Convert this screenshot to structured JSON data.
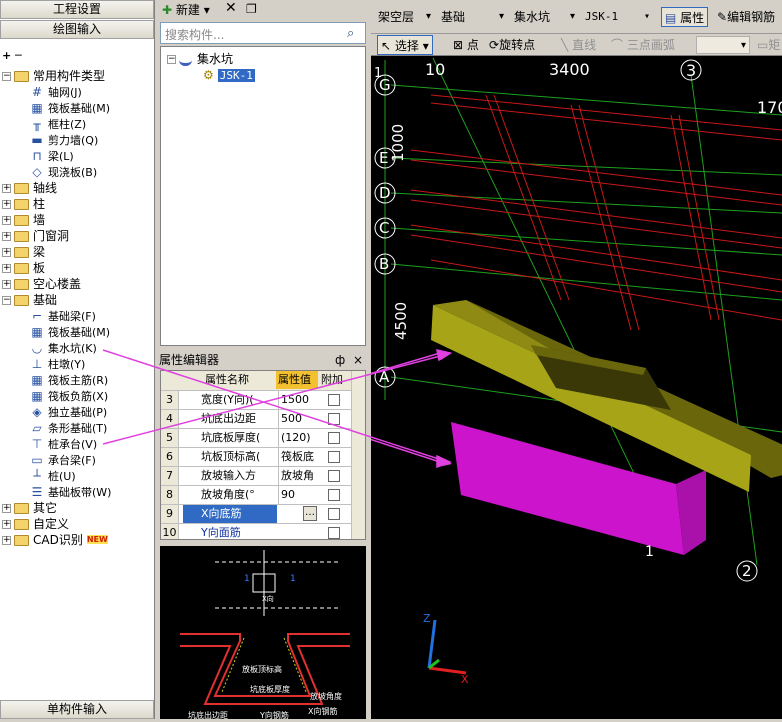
{
  "left_panel": {
    "top_button": "工程设置",
    "second_button": "绘图输入",
    "bottom_button": "单构件输入",
    "tree": [
      {
        "type": "folder",
        "label": "常用构件类型",
        "expanded": true
      },
      {
        "type": "item",
        "label": "轴网(J)",
        "icon": "grid-icon"
      },
      {
        "type": "item",
        "label": "筏板基础(M)",
        "icon": "raft-icon"
      },
      {
        "type": "item",
        "label": "框柱(Z)",
        "icon": "column-icon"
      },
      {
        "type": "item",
        "label": "剪力墙(Q)",
        "icon": "wall-icon"
      },
      {
        "type": "item",
        "label": "梁(L)",
        "icon": "beam-icon"
      },
      {
        "type": "item",
        "label": "现浇板(B)",
        "icon": "slab-icon"
      },
      {
        "type": "folder",
        "label": "轴线"
      },
      {
        "type": "folder",
        "label": "柱"
      },
      {
        "type": "folder",
        "label": "墙"
      },
      {
        "type": "folder",
        "label": "门窗洞"
      },
      {
        "type": "folder",
        "label": "梁"
      },
      {
        "type": "folder",
        "label": "板"
      },
      {
        "type": "folder",
        "label": "空心楼盖"
      },
      {
        "type": "folder",
        "label": "基础",
        "expanded": true
      },
      {
        "type": "item",
        "label": "基础梁(F)",
        "icon": "foundation-beam-icon"
      },
      {
        "type": "item",
        "label": "筏板基础(M)",
        "icon": "raft-icon"
      },
      {
        "type": "item",
        "label": "集水坑(K)",
        "icon": "sump-icon"
      },
      {
        "type": "item",
        "label": "柱墩(Y)",
        "icon": "pier-icon"
      },
      {
        "type": "item",
        "label": "筏板主筋(R)",
        "icon": "rebar-icon"
      },
      {
        "type": "item",
        "label": "筏板负筋(X)",
        "icon": "neg-rebar-icon"
      },
      {
        "type": "item",
        "label": "独立基础(P)",
        "icon": "isolated-foundation-icon"
      },
      {
        "type": "item",
        "label": "条形基础(T)",
        "icon": "strip-foundation-icon"
      },
      {
        "type": "item",
        "label": "桩承台(V)",
        "icon": "pile-cap-icon"
      },
      {
        "type": "item",
        "label": "承台梁(F)",
        "icon": "cap-beam-icon"
      },
      {
        "type": "item",
        "label": "桩(U)",
        "icon": "pile-icon"
      },
      {
        "type": "item",
        "label": "基础板带(W)",
        "icon": "strip-icon"
      },
      {
        "type": "folder",
        "label": "其它"
      },
      {
        "type": "folder",
        "label": "自定义"
      },
      {
        "type": "folder",
        "label": "CAD识别",
        "badge": "NEW"
      }
    ]
  },
  "middle_panel": {
    "new_button": "新建",
    "search_placeholder": "搜索构件...",
    "component_tree": {
      "root": "集水坑",
      "child": "JSK-1"
    },
    "prop_title": "属性编辑器",
    "pin_glyph": "ф",
    "close_glyph": "×",
    "headers": {
      "name": "属性名称",
      "value": "属性值",
      "extra": "附加"
    },
    "rows": [
      {
        "no": "3",
        "name": "宽度(Y向)(",
        "value": "1500"
      },
      {
        "no": "4",
        "name": "坑底出边距",
        "value": "500"
      },
      {
        "no": "5",
        "name": "坑底板厚度(",
        "value": "(120)"
      },
      {
        "no": "6",
        "name": "坑板顶标高(",
        "value": "筏板底"
      },
      {
        "no": "7",
        "name": "放坡输入方",
        "value": "放坡角"
      },
      {
        "no": "8",
        "name": "放坡角度(°",
        "value": "90"
      },
      {
        "no": "9",
        "name": "X向底筋",
        "value": "",
        "selected": true
      },
      {
        "no": "10",
        "name": "Y向面筋",
        "value": ""
      }
    ],
    "preview_labels": [
      "放板顶标高",
      "坑底板厚度",
      "放坡角度",
      "坑底出边距",
      "X向钢筋",
      "Y向钢筋"
    ]
  },
  "right_panel": {
    "toolbar1": {
      "floor": "架空层",
      "category": "基础",
      "type": "集水坑",
      "name": "JSK-1",
      "property": "属性",
      "edit_rebar": "编辑钢筋"
    },
    "toolbar2": {
      "select": "选择",
      "point": "点",
      "rotate_point": "旋转点",
      "line": "直线",
      "arc": "三点画弧",
      "rect": "矩"
    },
    "axis_labels": {
      "top_dims": [
        "10",
        "3400",
        "3",
        "170"
      ],
      "rows": [
        "G",
        "E",
        "D",
        "C",
        "B",
        "A"
      ],
      "left_dims": [
        "1000",
        "4500"
      ],
      "bottom_cols": [
        "1",
        "2"
      ],
      "dim_top_left": "1"
    },
    "colors": {
      "sump_top": "#7f7a14",
      "sump_bottom": "#cc14cc",
      "grid": "#1ea01e",
      "red": "#d01818",
      "arrow": "#e040e0"
    }
  }
}
